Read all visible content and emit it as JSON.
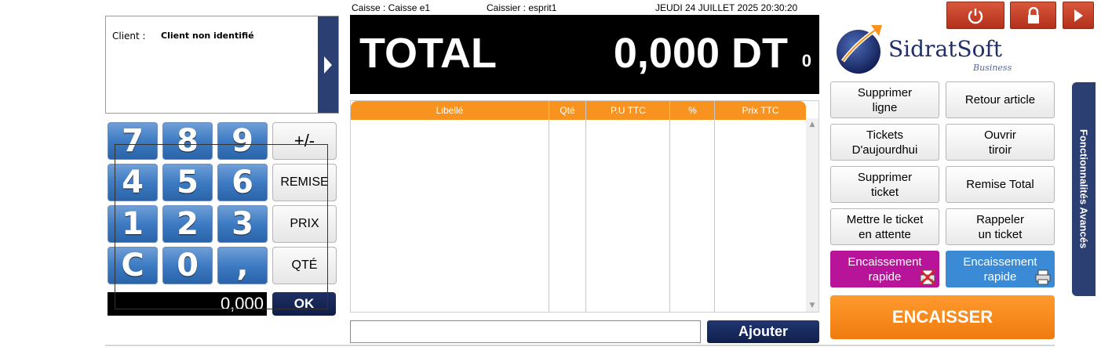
{
  "header": {
    "caisse": "Caisse : Caisse e1",
    "caissier": "Caissier : esprit1",
    "datetime": "JEUDI 24 JUILLET 2025 20:30:20"
  },
  "client": {
    "label": "Client :",
    "name": "Client non identifié",
    "arrow_icon": "chevron-right-icon"
  },
  "keypad": {
    "keys": [
      "7",
      "8",
      "9",
      "4",
      "5",
      "6",
      "1",
      "2",
      "3",
      "C",
      "0",
      ","
    ],
    "functions": {
      "plusminus": "+/-",
      "remise": "REMISE",
      "prix": "PRIX",
      "qte": "QTÉ"
    },
    "display": "0,000",
    "ok": "OK"
  },
  "total": {
    "label": "TOTAL",
    "amount": "0,000 DT",
    "count": "0"
  },
  "table": {
    "columns": [
      "Libellé",
      "Qté",
      "P.U TTC",
      "%",
      "Prix TTC"
    ],
    "rows": []
  },
  "add": {
    "input_value": "",
    "button": "Ajouter"
  },
  "top_buttons": [
    "power-icon",
    "lock-icon",
    "play-icon"
  ],
  "logo": {
    "name": "SidratSoft",
    "sub": "Business"
  },
  "functions": {
    "supprimer_ligne": "Supprimer\nligne",
    "retour_article": "Retour article",
    "tickets_auj": "Tickets\nD'aujourdhui",
    "ouvrir_tiroir": "Ouvrir\ntiroir",
    "supprimer_ticket": "Supprimer\nticket",
    "remise_total": "Remise Total",
    "mettre_attente": "Mettre le ticket\nen attente",
    "rappeler_ticket": "Rappeler\nun ticket",
    "encaissement_rapide_1": "Encaissement\nrapide",
    "encaissement_rapide_2": "Encaissement\nrapide",
    "encaisser": "ENCAISSER"
  },
  "side_tab": "Fonctionnalités Avancés",
  "colors": {
    "orange": "#f7931e",
    "navy": "#2c3f73",
    "magenta": "#b7149a",
    "blue": "#3a8ad6",
    "red": "#c63e25"
  }
}
